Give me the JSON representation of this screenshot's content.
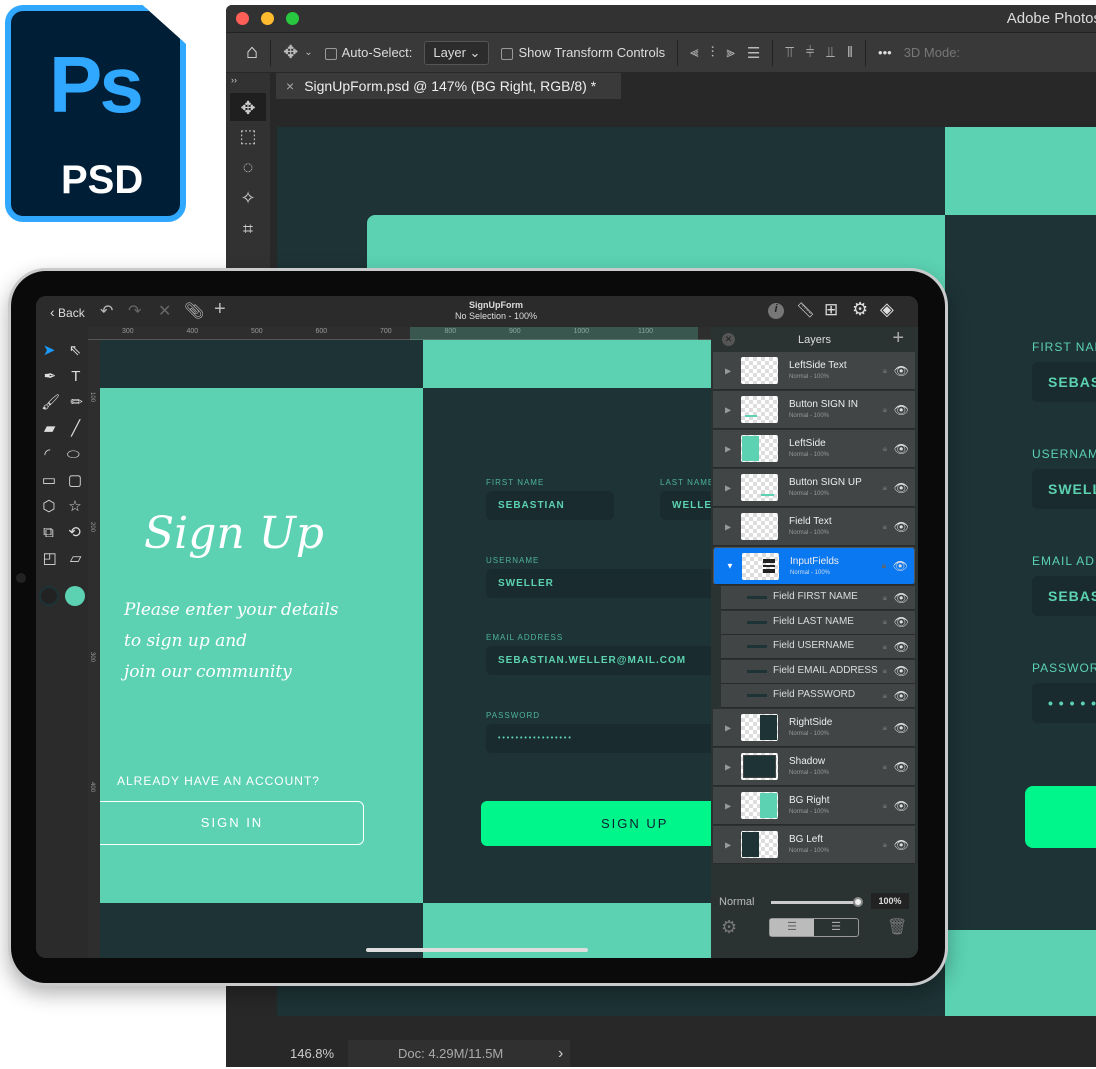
{
  "logo": {
    "text": "Ps",
    "label": "PSD"
  },
  "photoshop": {
    "app_title": "Adobe Photoshop",
    "options": {
      "auto_select": "Auto-Select:",
      "layer_select": "Layer",
      "show_transform": "Show Transform Controls",
      "more": "•••",
      "three_d": "3D Mode:"
    },
    "tab": {
      "close": "×",
      "title": "SignUpForm.psd @ 147% (BG Right, RGB/8) *"
    },
    "panel_collapse": "››",
    "doc_fields": [
      {
        "label": "FIRST NAM",
        "value": "SEBAST"
      },
      {
        "label": "USERNAM",
        "value": "SWELLE"
      },
      {
        "label": "EMAIL AD",
        "value": "SEBAST"
      },
      {
        "label": "PASSWOR",
        "value": "• • • • • •"
      }
    ],
    "status": {
      "zoom": "146.8%",
      "doc": "Doc: 4.29M/11.5M",
      "arrow": "›"
    }
  },
  "ipad": {
    "topbar": {
      "back": "Back",
      "title": "SignUpForm",
      "subtitle": "No Selection - 100%"
    },
    "ruler_ticks": [
      "300",
      "400",
      "500",
      "600",
      "700",
      "800",
      "900",
      "1000",
      "1100"
    ],
    "vruler_ticks": [
      "100",
      "200",
      "300",
      "400"
    ],
    "canvas": {
      "heading": "Sign Up",
      "tagline": [
        "Please enter your details",
        "to sign up and",
        "join our community"
      ],
      "have_account": "ALREADY HAVE AN ACCOUNT?",
      "sign_in": "SIGN IN",
      "fields": [
        {
          "label": "FIRST NAME",
          "value": "SEBASTIAN"
        },
        {
          "label": "LAST NAME",
          "value": "WELLER"
        },
        {
          "label": "USERNAME",
          "value": "SWELLER"
        },
        {
          "label": "EMAIL ADDRESS",
          "value": "SEBASTIAN.WELLER@MAIL.COM"
        },
        {
          "label": "PASSWORD",
          "value": "• • • • • • • • • • • • • • • • •"
        }
      ],
      "sign_up": "SIGN UP"
    },
    "layers": {
      "title": "Layers",
      "items": [
        {
          "name": "LeftSide Text",
          "mode": "Normal - 100%",
          "type": "group"
        },
        {
          "name": "Button SIGN IN",
          "mode": "Normal - 100%",
          "type": "group"
        },
        {
          "name": "LeftSide",
          "mode": "Normal - 100%",
          "type": "group"
        },
        {
          "name": "Button SIGN UP",
          "mode": "Normal - 100%",
          "type": "group"
        },
        {
          "name": "Field Text",
          "mode": "Normal - 100%",
          "type": "group"
        },
        {
          "name": "InputFields",
          "mode": "Normal - 100%",
          "type": "group",
          "selected": true,
          "expanded": true
        },
        {
          "name": "Field FIRST NAME",
          "type": "sub"
        },
        {
          "name": "Field LAST NAME",
          "type": "sub"
        },
        {
          "name": "Field USERNAME",
          "type": "sub"
        },
        {
          "name": "Field EMAIL ADDRESS",
          "type": "sub"
        },
        {
          "name": "Field PASSWORD",
          "type": "sub"
        },
        {
          "name": "RightSide",
          "mode": "Normal - 100%",
          "type": "group"
        },
        {
          "name": "Shadow",
          "mode": "Normal - 100%",
          "type": "group"
        },
        {
          "name": "BG Right",
          "mode": "Normal - 100%",
          "type": "group"
        },
        {
          "name": "BG Left",
          "mode": "Normal - 100%",
          "type": "group"
        }
      ],
      "blend_mode": "Normal",
      "opacity": "100%",
      "opacity_value": 100
    }
  },
  "colors": {
    "mint": "#5cd2b3",
    "dark_teal": "#1d3336",
    "green_button": "#00f58a",
    "selection_blue": "#0a78f0",
    "ps_blue": "#31a8ff"
  }
}
